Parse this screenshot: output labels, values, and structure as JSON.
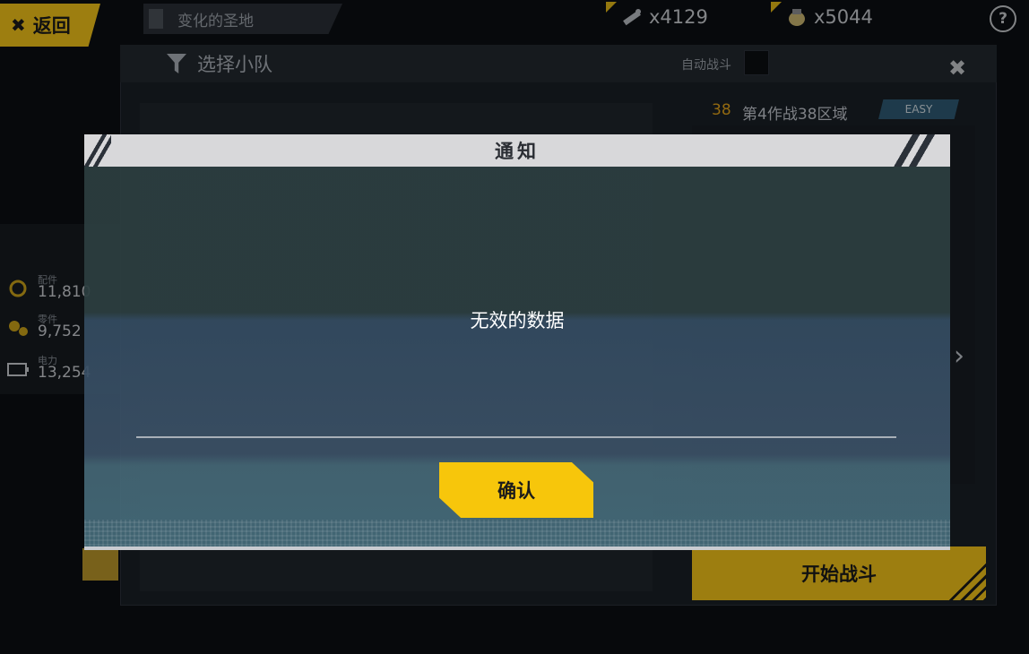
{
  "top_bar": {
    "back_label": "返回",
    "stage_tab_label": "变化的圣地",
    "resource_1_value": "x4129",
    "resource_2_value": "x5044",
    "help_label": "?"
  },
  "side_resources": [
    {
      "label": "配件",
      "value": "11,810"
    },
    {
      "label": "零件",
      "value": "9,752"
    },
    {
      "label": "电力",
      "value": "13,254"
    }
  ],
  "panel": {
    "title": "选择小队",
    "auto_battle_label": "自动战斗",
    "stage_number": "38",
    "stage_name": "第4作战38区域",
    "difficulty": "EASY",
    "start_button_label": "开始战斗"
  },
  "dialog": {
    "title": "通知",
    "message": "无效的数据",
    "confirm_label": "确认"
  },
  "colors": {
    "accent_yellow": "#f7c60b",
    "dialog_header": "#d8d8da",
    "easy_badge": "#2e5a73"
  }
}
